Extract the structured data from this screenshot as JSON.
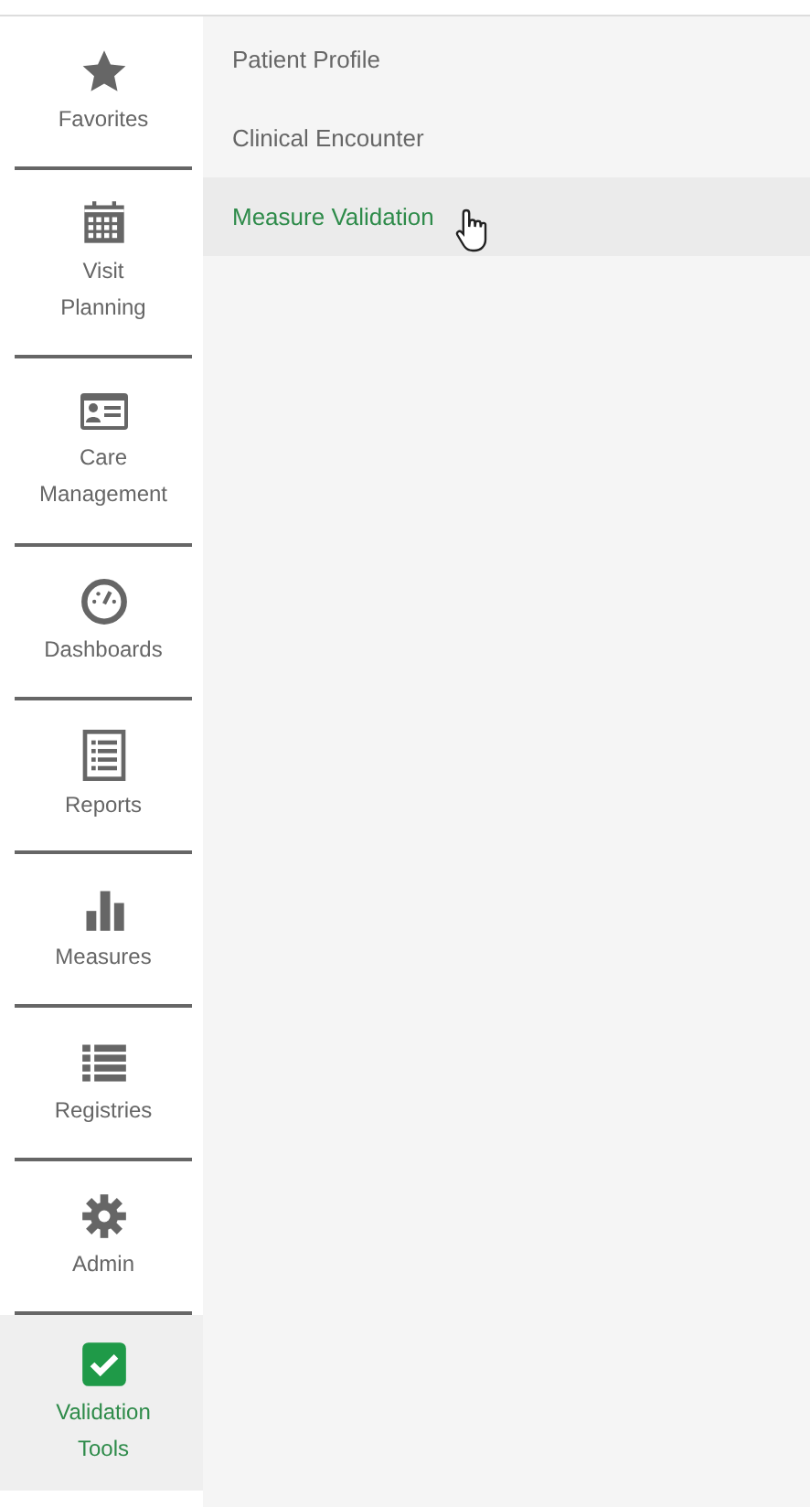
{
  "sidebar": {
    "items": [
      {
        "label": "Favorites",
        "selected": false
      },
      {
        "label": "Visit\nPlanning",
        "selected": false
      },
      {
        "label": "Care\nManagement",
        "selected": false
      },
      {
        "label": "Dashboards",
        "selected": false
      },
      {
        "label": "Reports",
        "selected": false
      },
      {
        "label": "Measures",
        "selected": false
      },
      {
        "label": "Registries",
        "selected": false
      },
      {
        "label": "Admin",
        "selected": false
      },
      {
        "label": "Validation\nTools",
        "selected": true
      }
    ]
  },
  "submenu": {
    "items": [
      {
        "label": "Patient Profile",
        "selected": false
      },
      {
        "label": "Clinical Encounter",
        "selected": false
      },
      {
        "label": "Measure Validation",
        "selected": true
      }
    ]
  }
}
